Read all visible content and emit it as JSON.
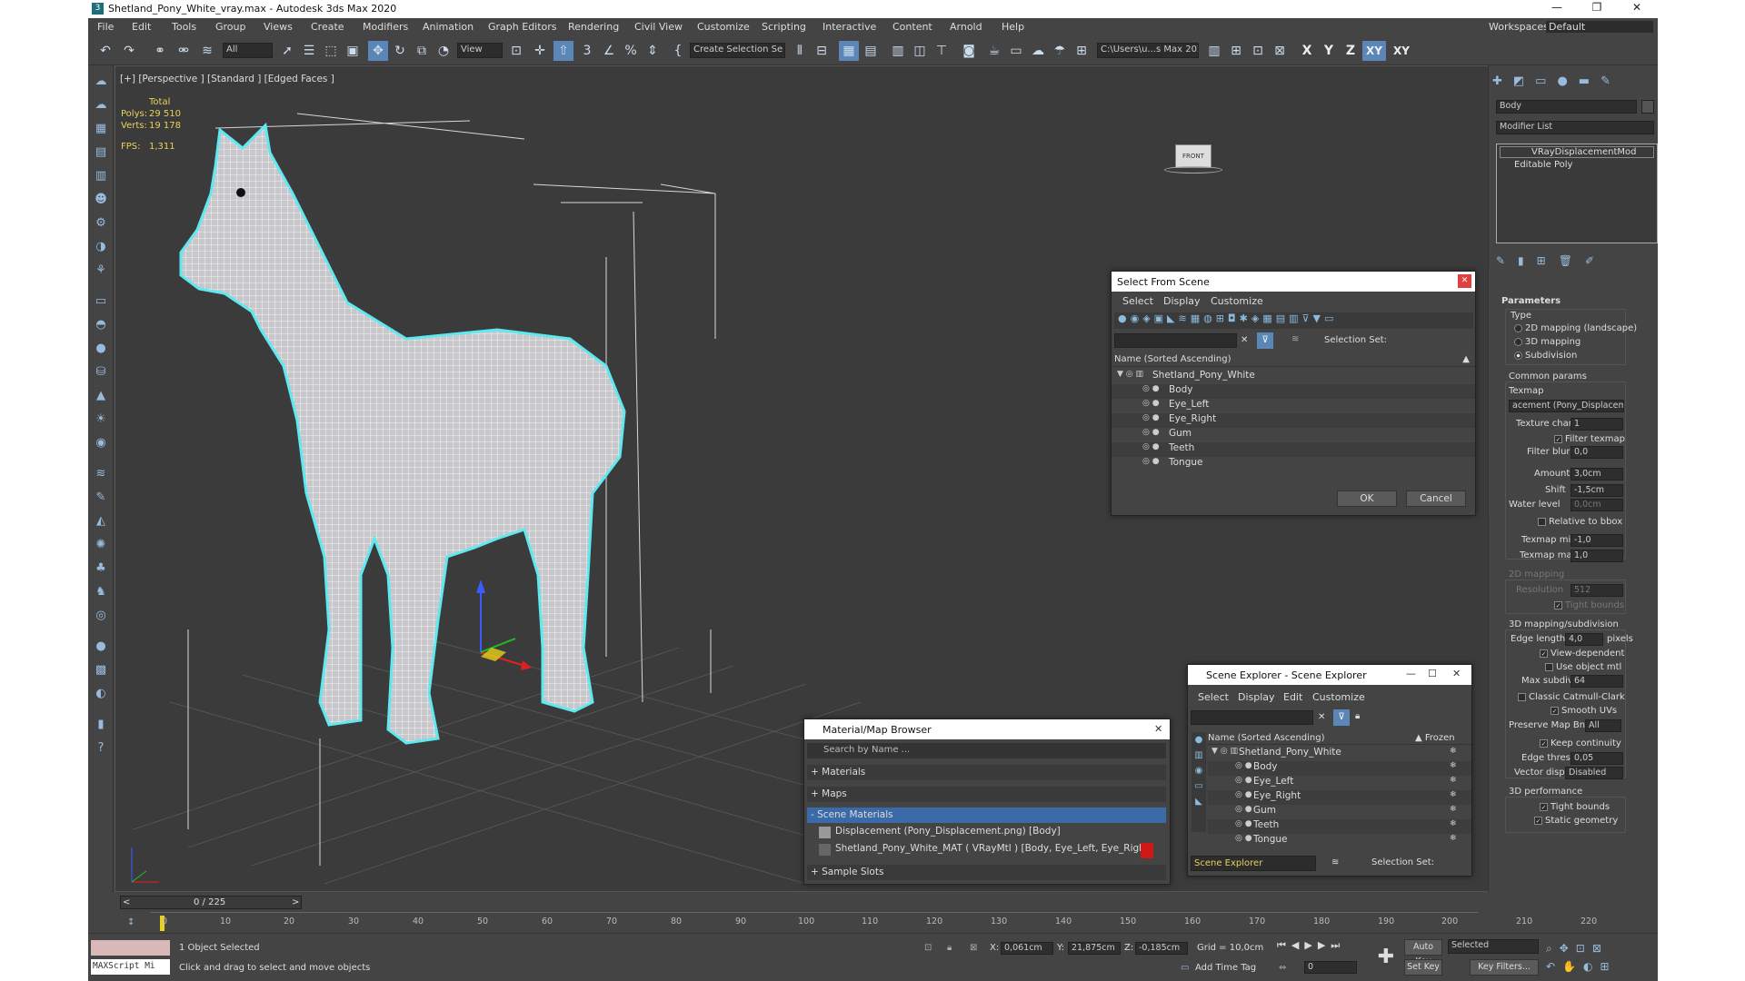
{
  "window": {
    "title": "Shetland_Pony_White_vray.max - Autodesk 3ds Max 2020",
    "min": "—",
    "max": "❐",
    "close": "✕"
  },
  "menu": [
    "File",
    "Edit",
    "Tools",
    "Group",
    "Views",
    "Create",
    "Modifiers",
    "Animation",
    "Graph Editors",
    "Rendering",
    "Civil View",
    "Customize",
    "Scripting",
    "Interactive",
    "Content",
    "Arnold",
    "Help"
  ],
  "workspace": {
    "label": "Workspaces:",
    "value": "Default"
  },
  "toolbar": {
    "filter": "All",
    "ref_coord": "View",
    "selection_set": "Create Selection Se",
    "path": "C:\\Users\\u...s Max 2020",
    "axes": [
      "X",
      "Y",
      "Z",
      "XY",
      "XY"
    ]
  },
  "viewport": {
    "label": "[+] [Perspective ] [Standard ] [Edged Faces ]",
    "stats": {
      "total": "Total",
      "polys_label": "Polys:",
      "polys": "29 510",
      "verts_label": "Verts:",
      "verts": "19 178",
      "fps_label": "FPS:",
      "fps": "1,311"
    },
    "viewcube": "FRONT"
  },
  "cmdpanel": {
    "name": "Body",
    "modifier_list": "Modifier List",
    "stack": [
      "VRayDisplacementMod",
      "Editable Poly"
    ],
    "rollout": "Parameters",
    "type_label": "Type",
    "types": [
      "2D mapping (landscape)",
      "3D mapping",
      "Subdivision"
    ],
    "common": "Common params",
    "texmap": "Texmap",
    "texmap_value": "acement (Pony_Displacement.",
    "texture_chan": "Texture chan",
    "texture_chan_val": "1",
    "filter_texmap": "Filter texmap",
    "filter_blur": "Filter blur",
    "filter_blur_val": "0,0",
    "amount": "Amount",
    "amount_val": "3,0cm",
    "shift": "Shift",
    "shift_val": "-1,5cm",
    "water_level": "Water level",
    "water_val": "0,0cm",
    "relative": "Relative to bbox",
    "tmin": "Texmap min",
    "tmin_val": "-1,0",
    "tmax": "Texmap max",
    "tmax_val": "1,0",
    "map2d": "2D mapping",
    "resolution": "Resolution",
    "resolution_val": "512",
    "tight": "Tight bounds",
    "map3d": "3D mapping/subdivision",
    "edge_length": "Edge length",
    "edge_length_val": "4,0",
    "pixels": "pixels",
    "view_dep": "View-dependent",
    "use_obj": "Use object mtl",
    "max_subdivs": "Max subdivs",
    "max_subdivs_val": "64",
    "catmull": "Classic Catmull-Clark",
    "smooth_uvs": "Smooth UVs",
    "preserve": "Preserve Map Bnd",
    "preserve_val": "All",
    "keep": "Keep continuity",
    "edge_thresh": "Edge thresh",
    "edge_thresh_val": "0,05",
    "vector": "Vector displ",
    "vector_val": "Disabled",
    "perf": "3D performance",
    "tight2": "Tight bounds",
    "static": "Static geometry"
  },
  "select_dlg": {
    "title": "Select From Scene",
    "menu": [
      "Select",
      "Display",
      "Customize"
    ],
    "selset": "Selection Set:",
    "header": "Name (Sorted Ascending)",
    "root": "Shetland_Pony_White",
    "items": [
      "Body",
      "Eye_Left",
      "Eye_Right",
      "Gum",
      "Teeth",
      "Tongue"
    ],
    "ok": "OK",
    "cancel": "Cancel"
  },
  "explorer": {
    "title": "Scene Explorer - Scene Explorer",
    "menu": [
      "Select",
      "Display",
      "Edit",
      "Customize"
    ],
    "header": "Name (Sorted Ascending)",
    "frozen": "▲ Frozen",
    "root": "Shetland_Pony_White",
    "items": [
      "Body",
      "Eye_Left",
      "Eye_Right",
      "Gum",
      "Teeth",
      "Tongue"
    ],
    "footer": "Scene Explorer",
    "selset": "Selection Set:"
  },
  "matbrowser": {
    "title": "Material/Map Browser",
    "search": "Search by Name ...",
    "sections": [
      "+ Materials",
      "+ Maps",
      "- Scene Materials",
      "+ Sample Slots"
    ],
    "mat1": "Displacement (Pony_Displacement.png) [Body]",
    "mat2": "Shetland_Pony_White_MAT  ( VRayMtl ) [Body, Eye_Left, Eye_Right, Gum,..."
  },
  "timeline": {
    "frame": "0 / 225",
    "ticks": [
      "0",
      "10",
      "20",
      "30",
      "40",
      "50",
      "60",
      "70",
      "80",
      "90",
      "100",
      "110",
      "120",
      "130",
      "140",
      "150",
      "160",
      "170",
      "180",
      "190",
      "200",
      "210",
      "220"
    ]
  },
  "status": {
    "maxscript": "MAXScript Mi",
    "selected": "1 Object Selected",
    "hint": "Click and drag to select and move objects",
    "x_label": "X:",
    "x": "0,061cm",
    "y_label": "Y:",
    "y": "21,875cm",
    "z_label": "Z:",
    "z": "-0,185cm",
    "grid": "Grid = 10,0cm",
    "add_time_tag": "Add Time Tag",
    "auto_key": "Auto Key",
    "set_key": "Set Key",
    "selected_dd": "Selected",
    "key_filters": "Key Filters...",
    "frame_val": "0"
  }
}
